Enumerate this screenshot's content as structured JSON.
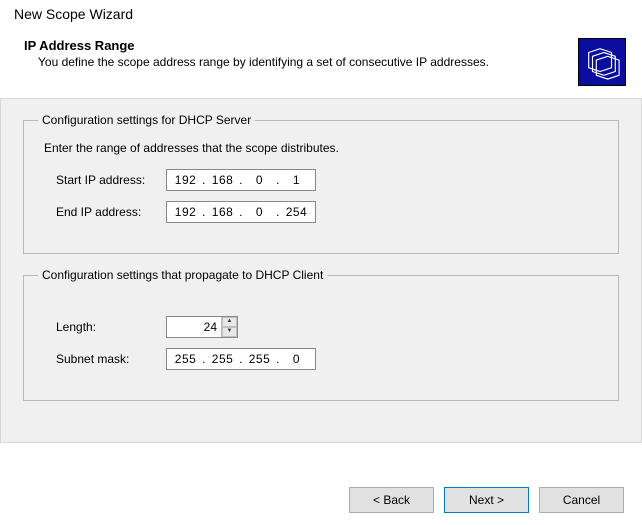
{
  "wizard_title": "New Scope Wizard",
  "header": {
    "title": "IP Address Range",
    "description": "You define the scope address range by identifying a set of consecutive IP addresses."
  },
  "group_server": {
    "legend": "Configuration settings for DHCP Server",
    "intro": "Enter the range of addresses that the scope distributes.",
    "start_label": "Start IP address:",
    "end_label": "End IP address:",
    "start_ip": {
      "a": "192",
      "b": "168",
      "c": "0",
      "d": "1"
    },
    "end_ip": {
      "a": "192",
      "b": "168",
      "c": "0",
      "d": "254"
    }
  },
  "group_client": {
    "legend": "Configuration settings that propagate to DHCP Client",
    "length_label": "Length:",
    "length_value": "24",
    "mask_label": "Subnet mask:",
    "mask": {
      "a": "255",
      "b": "255",
      "c": "255",
      "d": "0"
    }
  },
  "buttons": {
    "back": "< Back",
    "next": "Next >",
    "cancel": "Cancel"
  }
}
